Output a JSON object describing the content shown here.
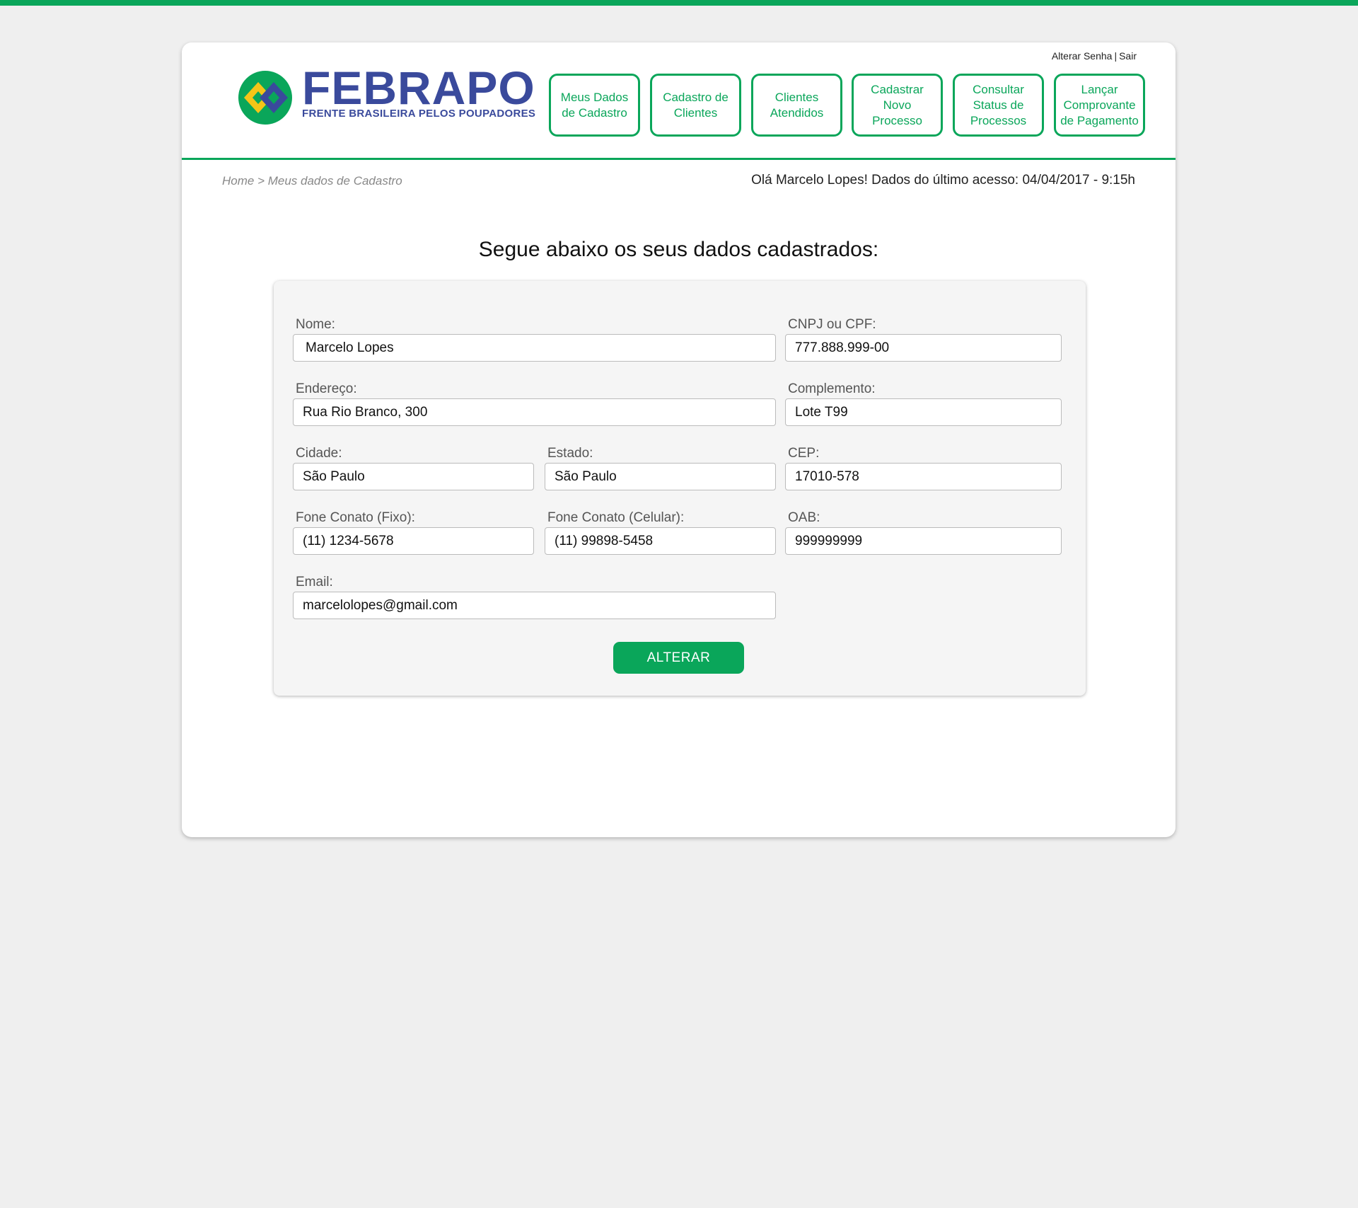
{
  "header": {
    "logo_title": "FEBRAPO",
    "logo_subtitle": "FRENTE BRASILEIRA PELOS POUPADORES",
    "top_links": {
      "change_password": "Alterar Senha",
      "separator": "|",
      "logout": "Sair"
    },
    "nav": [
      "Meus Dados de Cadastro",
      "Cadastro de Clientes",
      "Clientes Atendidos",
      "Cadastrar Novo Processo",
      "Consultar Status de Processos",
      "Lançar Comprovante de Pagamento"
    ]
  },
  "breadcrumb": "Home > Meus dados de Cadastro",
  "greeting": "Olá Marcelo Lopes! Dados do último acesso: 04/04/2017 - 9:15h",
  "heading": "Segue abaixo os seus dados cadastrados:",
  "form": {
    "nome": {
      "label": "Nome:",
      "value": "Marcelo Lopes"
    },
    "cnpj": {
      "label": "CNPJ ou CPF:",
      "value": "777.888.999-00"
    },
    "endereco": {
      "label": "Endereço:",
      "value": "Rua Rio Branco, 300"
    },
    "complemento": {
      "label": "Complemento:",
      "value": "Lote T99"
    },
    "cidade": {
      "label": "Cidade:",
      "value": "São Paulo"
    },
    "estado": {
      "label": "Estado:",
      "value": "São Paulo"
    },
    "cep": {
      "label": "CEP:",
      "value": "17010-578"
    },
    "fone_fixo": {
      "label": "Fone Conato (Fixo):",
      "value": "(11) 1234-5678"
    },
    "fone_celular": {
      "label": "Fone Conato (Celular):",
      "value": "(11) 99898-5458"
    },
    "oab": {
      "label": "OAB:",
      "value": "999999999"
    },
    "email": {
      "label": "Email:",
      "value": "marcelolopes@gmail.com"
    },
    "submit_label": "ALTERAR"
  },
  "colors": {
    "accent_green": "#0aa65a",
    "logo_blue": "#3a4a9c",
    "logo_yellow": "#f5c518",
    "background": "#efefef"
  }
}
